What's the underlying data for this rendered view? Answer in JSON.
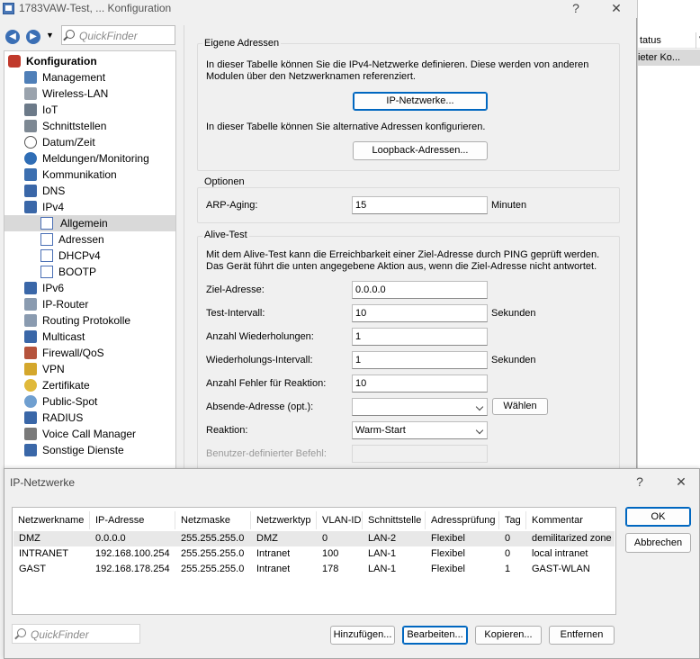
{
  "window": {
    "title": "1783VAW-Test, ... Konfiguration",
    "help_label": "?",
    "close_label": "✕"
  },
  "background_window": {
    "col1": "tatus",
    "col2": "V",
    "row_text": "ieter Ko..."
  },
  "nav": {
    "back_icon": "back-arrow-icon",
    "forward_icon": "forward-arrow-icon",
    "dropdown_icon": "chevron-down-icon",
    "quickfinder_placeholder": "QuickFinder"
  },
  "tree": {
    "root": "Konfiguration",
    "items": [
      {
        "label": "Management"
      },
      {
        "label": "Wireless-LAN"
      },
      {
        "label": "IoT"
      },
      {
        "label": "Schnittstellen"
      },
      {
        "label": "Datum/Zeit"
      },
      {
        "label": "Meldungen/Monitoring"
      },
      {
        "label": "Kommunikation"
      },
      {
        "label": "DNS"
      },
      {
        "label": "IPv4"
      },
      {
        "label": "Allgemein"
      },
      {
        "label": "Adressen"
      },
      {
        "label": "DHCPv4"
      },
      {
        "label": "BOOTP"
      },
      {
        "label": "IPv6"
      },
      {
        "label": "IP-Router"
      },
      {
        "label": "Routing Protokolle"
      },
      {
        "label": "Multicast"
      },
      {
        "label": "Firewall/QoS"
      },
      {
        "label": "VPN"
      },
      {
        "label": "Zertifikate"
      },
      {
        "label": "Public-Spot"
      },
      {
        "label": "RADIUS"
      },
      {
        "label": "Voice Call Manager"
      },
      {
        "label": "Sonstige Dienste"
      }
    ]
  },
  "eigene_adressen": {
    "title": "Eigene Adressen",
    "desc1": "In dieser Tabelle können Sie die IPv4-Netzwerke definieren. Diese werden von anderen Modulen über den Netzwerknamen referenziert.",
    "btn_ip": "IP-Netzwerke...",
    "desc2": "In dieser Tabelle können Sie alternative Adressen konfigurieren.",
    "btn_loopback": "Loopback-Adressen..."
  },
  "optionen": {
    "title": "Optionen",
    "arp_label": "ARP-Aging:",
    "arp_value": "15",
    "arp_unit": "Minuten"
  },
  "alive": {
    "title": "Alive-Test",
    "desc": "Mit dem Alive-Test kann die Erreichbarkeit einer Ziel-Adresse durch PING geprüft werden. Das Gerät führt die unten angegebene Aktion aus, wenn die Ziel-Adresse nicht antwortet.",
    "ziel_label": "Ziel-Adresse:",
    "ziel_value": "0.0.0.0",
    "intervall_label": "Test-Intervall:",
    "intervall_value": "10",
    "intervall_unit": "Sekunden",
    "wiederholungen_label": "Anzahl Wiederholungen:",
    "wiederholungen_value": "1",
    "wiederholungs_intervall_label": "Wiederholungs-Intervall:",
    "wiederholungs_intervall_value": "1",
    "wiederholungs_intervall_unit": "Sekunden",
    "fehler_label": "Anzahl Fehler für Reaktion:",
    "fehler_value": "10",
    "absende_label": "Absende-Adresse (opt.):",
    "absende_value": "",
    "waehlen_label": "Wählen",
    "reaktion_label": "Reaktion:",
    "reaktion_value": "Warm-Start",
    "befehl_label": "Benutzer-definierter Befehl:"
  },
  "dialog": {
    "title": "IP-Netzwerke",
    "help_label": "?",
    "close_label": "✕",
    "columns": [
      "Netzwerkname",
      "IP-Adresse",
      "Netzmaske",
      "Netzwerktyp",
      "VLAN-ID",
      "Schnittstelle",
      "Adressprüfung",
      "Tag",
      "Kommentar"
    ],
    "rows": [
      [
        "DMZ",
        "0.0.0.0",
        "255.255.255.0",
        "DMZ",
        "0",
        "LAN-2",
        "Flexibel",
        "0",
        "demilitarized zone"
      ],
      [
        "INTRANET",
        "192.168.100.254",
        "255.255.255.0",
        "Intranet",
        "100",
        "LAN-1",
        "Flexibel",
        "0",
        "local intranet"
      ],
      [
        "GAST",
        "192.168.178.254",
        "255.255.255.0",
        "Intranet",
        "178",
        "LAN-1",
        "Flexibel",
        "1",
        "GAST-WLAN"
      ]
    ],
    "ok_label": "OK",
    "abbrechen_label": "Abbrechen",
    "quickfinder_placeholder": "QuickFinder",
    "hinzufuegen_label": "Hinzufügen...",
    "bearbeiten_label": "Bearbeiten...",
    "kopieren_label": "Kopieren...",
    "entfernen_label": "Entfernen"
  }
}
